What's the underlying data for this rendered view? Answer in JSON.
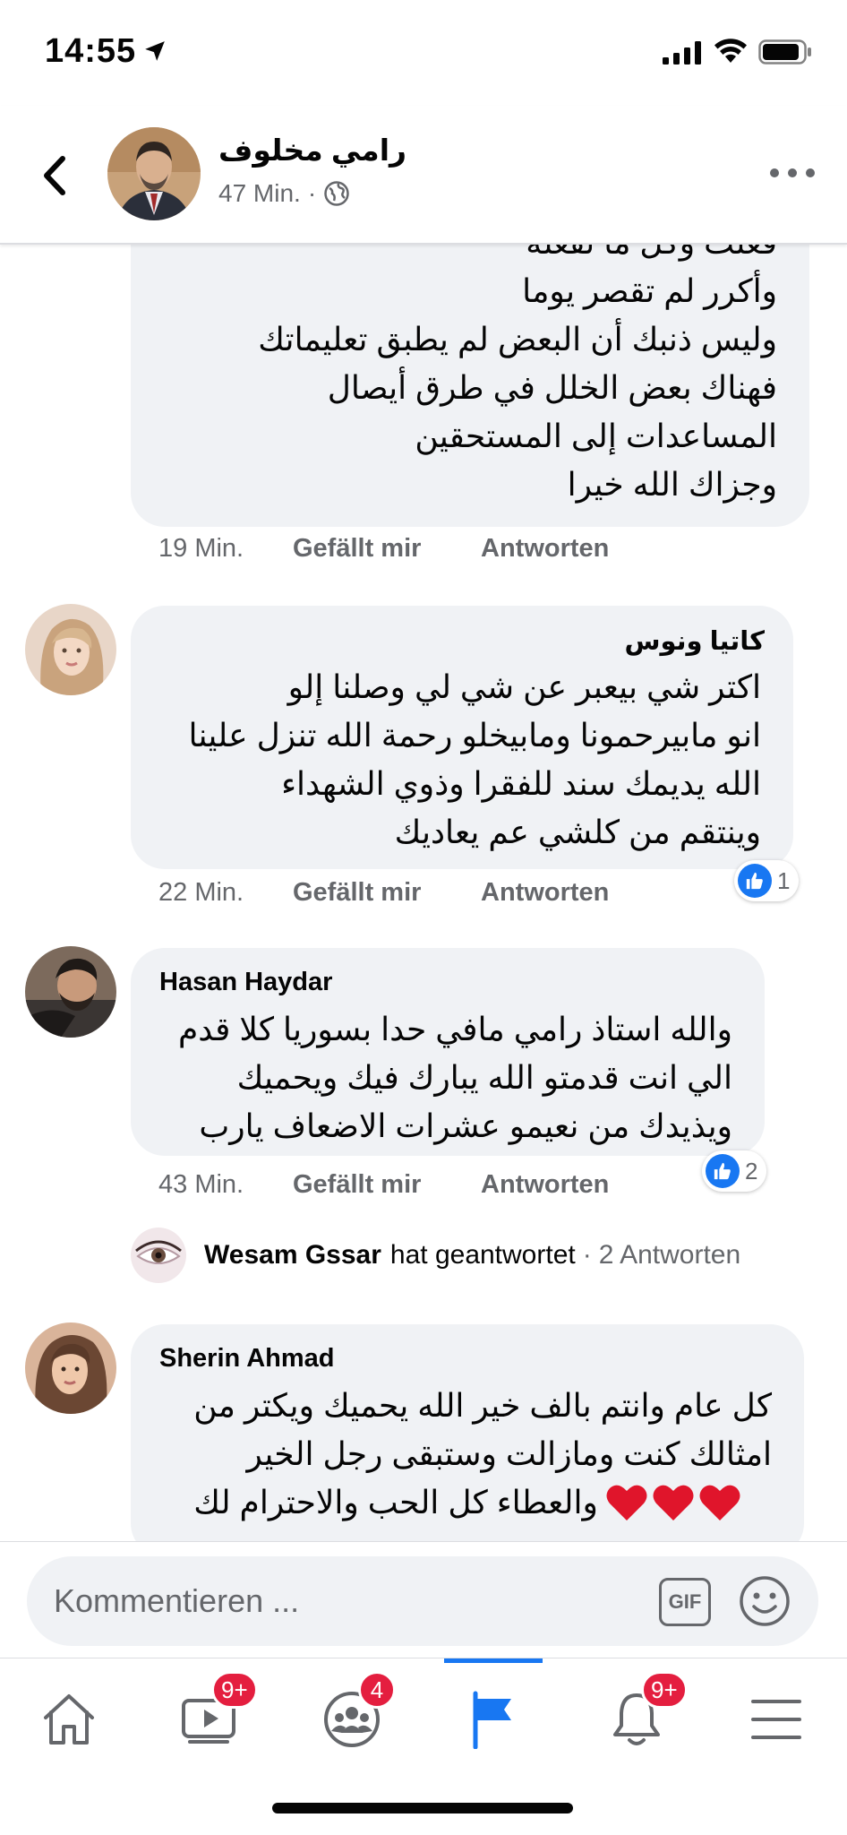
{
  "status_bar": {
    "time": "14:55"
  },
  "header": {
    "page_name": "رامي مخلوف",
    "time_ago": "47 Min.",
    "separator": "·"
  },
  "comments": [
    {
      "author": "",
      "lines": [
        "فعلت وكل ما تفعله",
        "وأكرر لم تقصر يوما",
        "وليس ذنبك أن البعض لم يطبق تعليماتك",
        "فهناك بعض الخلل في طرق أيصال",
        "المساعدات إلى المستحقين",
        "وجزاك الله خيرا"
      ],
      "time": "19 Min.",
      "like_label": "Gefällt mir",
      "reply_label": "Antworten"
    },
    {
      "author": "كاتيا ونوس",
      "lines": [
        "اكتر شي بيعبر عن شي لي وصلنا إلو",
        "انو مابيرحمونا ومابيخلو رحمة الله تنزل علينا",
        "الله يديمك سند للفقرا وذوي الشهداء",
        "وينتقم من كلشي عم يعاديك"
      ],
      "time": "22 Min.",
      "like_label": "Gefällt mir",
      "reply_label": "Antworten",
      "reactions": "1"
    },
    {
      "author": "Hasan Haydar",
      "lines": [
        "والله استاذ رامي مافي حدا بسوريا كلا قدم",
        "الي انت قدمتو الله يبارك فيك ويحميك",
        "ويذيدك من  نعيمو عشرات الاضعاف يارب"
      ],
      "time": "43 Min.",
      "like_label": "Gefällt mir",
      "reply_label": "Antworten",
      "reactions": "2"
    },
    {
      "author": "Sherin Ahmad",
      "lines": [
        "كل عام وانتم بالف خير  الله يحميك ويكتر من",
        "امثالك كنت ومازالت وستبقى رجل الخير",
        "والعطاء كل الحب والاحترام لك"
      ]
    }
  ],
  "reply_summary": {
    "name": "Wesam Gssar",
    "text": "hat geantwortet",
    "separator": "·",
    "count": "2 Antworten"
  },
  "composer": {
    "placeholder": "Kommentieren ...",
    "gif_label": "GIF"
  },
  "bottom_nav": {
    "watch_badge": "9+",
    "groups_badge": "4",
    "notifications_badge": "9+"
  },
  "colors": {
    "accent": "#1877f2",
    "badge": "#e41e3f",
    "bubble": "#f0f2f5",
    "heart": "#e0152b"
  }
}
